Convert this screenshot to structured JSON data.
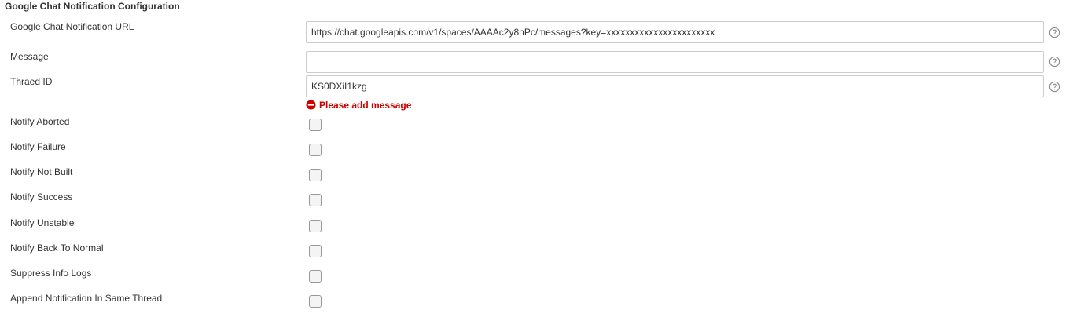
{
  "section": {
    "title": "Google Chat Notification Configuration"
  },
  "fields": {
    "url": {
      "label": "Google Chat Notification URL",
      "value": "https://chat.googleapis.com/v1/spaces/AAAAc2y8nPc/messages?key=xxxxxxxxxxxxxxxxxxxxxxx"
    },
    "message": {
      "label": "Message",
      "value": ""
    },
    "thread_id": {
      "label": "Thraed ID",
      "value": "KS0DXiI1kzg"
    }
  },
  "error": {
    "text": "Please add message",
    "color": "#cc0000"
  },
  "options": [
    {
      "label": "Notify Aborted",
      "checked": false
    },
    {
      "label": "Notify Failure",
      "checked": false
    },
    {
      "label": "Notify Not Built",
      "checked": false
    },
    {
      "label": "Notify Success",
      "checked": false
    },
    {
      "label": "Notify Unstable",
      "checked": false
    },
    {
      "label": "Notify Back To Normal",
      "checked": false
    },
    {
      "label": "Suppress Info Logs",
      "checked": false
    },
    {
      "label": "Append Notification In Same Thread",
      "checked": false
    }
  ],
  "icons": {
    "help": "help-circle-icon",
    "error": "error-minus-circle-icon"
  }
}
